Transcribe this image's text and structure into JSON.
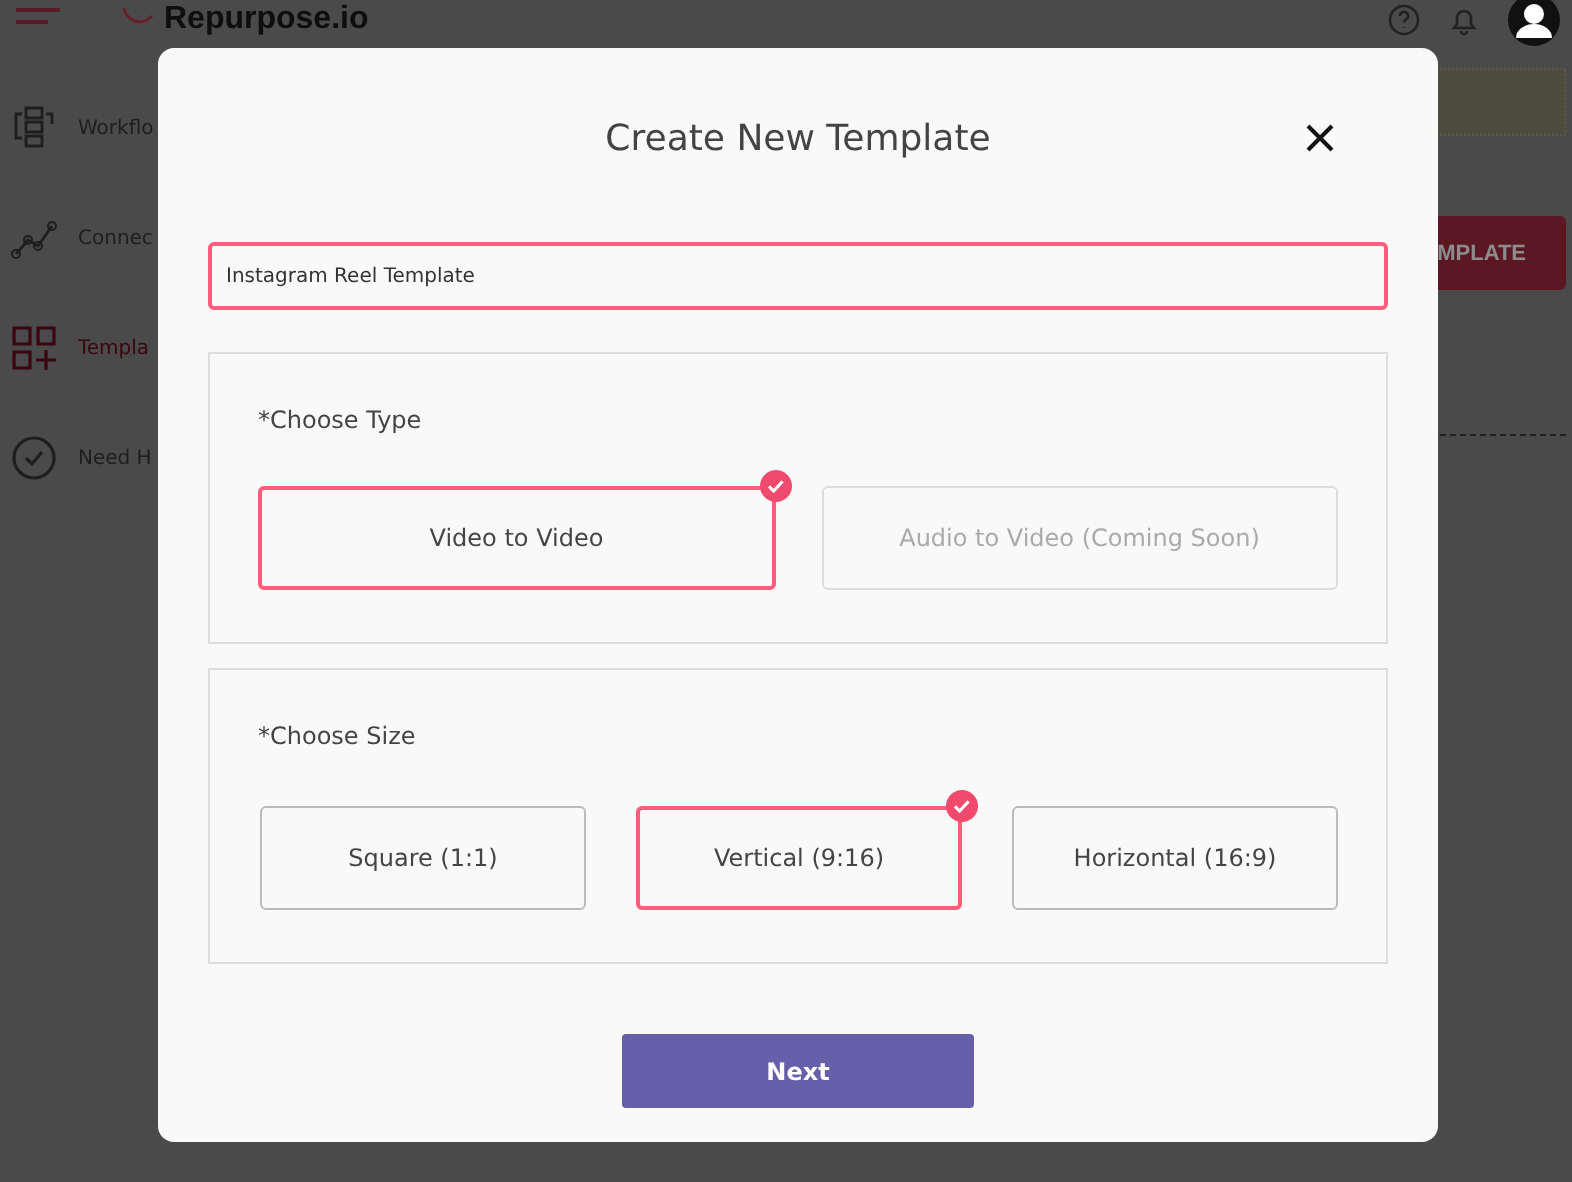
{
  "app": {
    "logo": "Repurpose.io"
  },
  "sidebar": {
    "items": [
      {
        "label": "Workflo",
        "selected": false
      },
      {
        "label": "Connec",
        "selected": false
      },
      {
        "label": "Templa",
        "selected": true
      },
      {
        "label": "Need H",
        "selected": false
      }
    ]
  },
  "page": {
    "button": "MPLATE"
  },
  "modal": {
    "title": "Create New Template",
    "name_field": {
      "value": "Instagram Reel Template"
    },
    "type_section": {
      "label": "*Choose Type",
      "options": [
        {
          "label": "Video to Video",
          "selected": true,
          "disabled": false
        },
        {
          "label": "Audio to Video (Coming Soon)",
          "selected": false,
          "disabled": true
        }
      ]
    },
    "size_section": {
      "label": "*Choose Size",
      "options": [
        {
          "label": "Square (1:1)",
          "selected": false
        },
        {
          "label": "Vertical (9:16)",
          "selected": true
        },
        {
          "label": "Horizontal (16:9)",
          "selected": false
        }
      ]
    },
    "next_button": "Next"
  }
}
